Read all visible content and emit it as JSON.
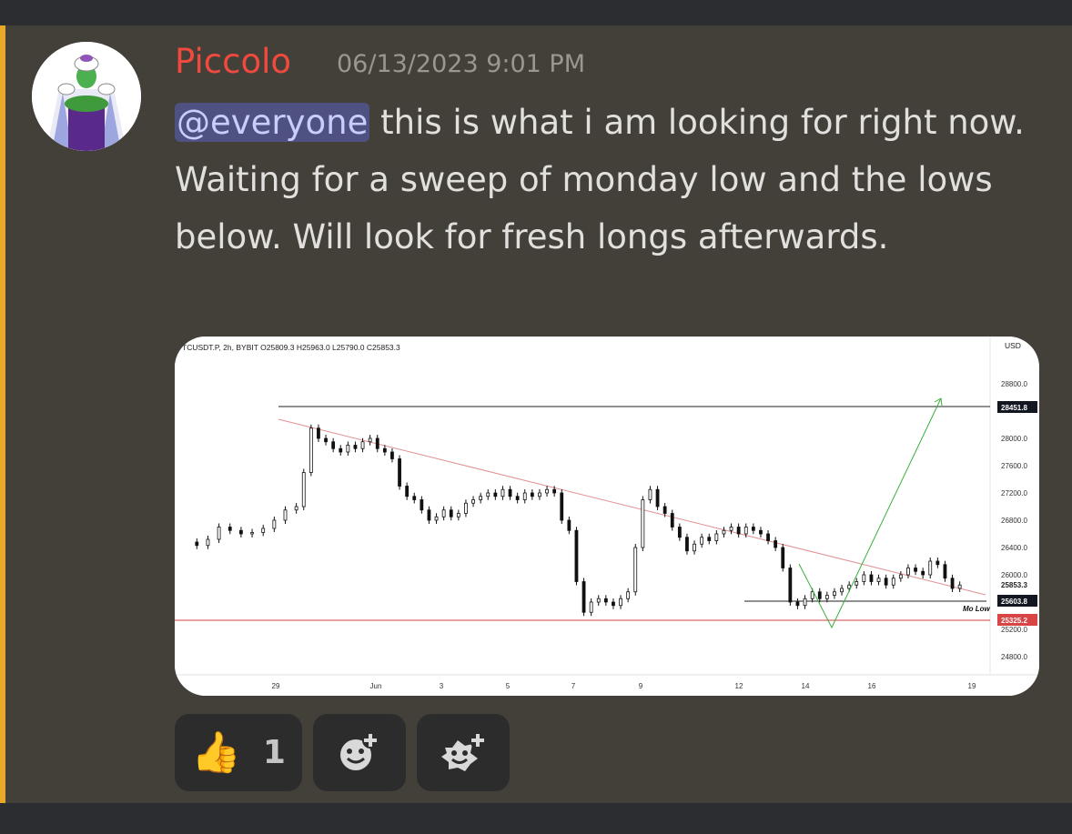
{
  "message": {
    "username": "Piccolo",
    "timestamp": "06/13/2023 9:01 PM",
    "mention": "@everyone",
    "text": " this is what i am looking for right now. Waiting for a sweep of monday low and the lows below. Will look for fresh longs afterwards.",
    "colors": {
      "username": "#f04a3e",
      "accent": "#e8a829",
      "mention_bg": "#4f5183"
    }
  },
  "chart": {
    "header": "TCUSDT.P, 2h, BYBIT  O25809.3  H25963.0  L25790.0  C25853.3",
    "currency": "USD",
    "annotation": "Mo Low",
    "chart_data": {
      "type": "candlestick",
      "symbol": "TCUSDT.P",
      "interval": "2h",
      "exchange": "BYBIT",
      "ohlc_last": {
        "open": 25809.3,
        "high": 25963.0,
        "low": 25790.0,
        "close": 25853.3
      },
      "y_ticks": [
        "28800.0",
        "28000.0",
        "27600.0",
        "27200.0",
        "26800.0",
        "26400.0",
        "26000.0",
        "25200.0",
        "24800.0"
      ],
      "x_ticks": [
        "29",
        "Jun",
        "3",
        "5",
        "7",
        "9",
        "12",
        "14",
        "16",
        "19"
      ],
      "price_labels": [
        {
          "value": "28451.8",
          "style": "dark"
        },
        {
          "value": "25853.3",
          "style": "plain"
        },
        {
          "value": "25603.8",
          "style": "dark"
        },
        {
          "value": "25325.2",
          "style": "red"
        }
      ],
      "annotations": [
        "Mo Low"
      ],
      "path_points": [
        [
          3,
          26480
        ],
        [
          6,
          26430
        ],
        [
          9,
          26520
        ],
        [
          12,
          26700
        ],
        [
          15,
          26650
        ],
        [
          18,
          26600
        ],
        [
          21,
          26620
        ],
        [
          24,
          26680
        ],
        [
          27,
          26800
        ],
        [
          30,
          26950
        ],
        [
          33,
          27000
        ],
        [
          35,
          27500
        ],
        [
          37,
          28150
        ],
        [
          39,
          28000
        ],
        [
          41,
          27950
        ],
        [
          43,
          27850
        ],
        [
          45,
          27800
        ],
        [
          47,
          27900
        ],
        [
          49,
          27850
        ],
        [
          51,
          27950
        ],
        [
          53,
          28000
        ],
        [
          55,
          27850
        ],
        [
          57,
          27800
        ],
        [
          59,
          27700
        ],
        [
          61,
          27300
        ],
        [
          63,
          27150
        ],
        [
          65,
          27100
        ],
        [
          67,
          26950
        ],
        [
          69,
          26800
        ],
        [
          71,
          26850
        ],
        [
          73,
          26950
        ],
        [
          75,
          26850
        ],
        [
          77,
          26900
        ],
        [
          79,
          27050
        ],
        [
          81,
          27100
        ],
        [
          83,
          27150
        ],
        [
          85,
          27200
        ],
        [
          87,
          27150
        ],
        [
          89,
          27250
        ],
        [
          91,
          27150
        ],
        [
          93,
          27100
        ],
        [
          95,
          27200
        ],
        [
          97,
          27150
        ],
        [
          99,
          27200
        ],
        [
          101,
          27250
        ],
        [
          103,
          27200
        ],
        [
          105,
          26800
        ],
        [
          107,
          26650
        ],
        [
          109,
          25900
        ],
        [
          111,
          25450
        ],
        [
          113,
          25600
        ],
        [
          115,
          25650
        ],
        [
          117,
          25600
        ],
        [
          119,
          25550
        ],
        [
          121,
          25650
        ],
        [
          123,
          25750
        ],
        [
          125,
          26400
        ],
        [
          127,
          27100
        ],
        [
          129,
          27250
        ],
        [
          131,
          27000
        ],
        [
          133,
          26900
        ],
        [
          135,
          26700
        ],
        [
          137,
          26550
        ],
        [
          139,
          26350
        ],
        [
          141,
          26450
        ],
        [
          143,
          26550
        ],
        [
          145,
          26500
        ],
        [
          147,
          26600
        ],
        [
          149,
          26650
        ],
        [
          151,
          26700
        ],
        [
          153,
          26600
        ],
        [
          155,
          26700
        ],
        [
          157,
          26650
        ],
        [
          159,
          26600
        ],
        [
          161,
          26500
        ],
        [
          163,
          26400
        ],
        [
          165,
          26100
        ],
        [
          167,
          25600
        ],
        [
          169,
          25550
        ],
        [
          171,
          25650
        ],
        [
          173,
          25750
        ],
        [
          175,
          25650
        ],
        [
          177,
          25700
        ],
        [
          179,
          25750
        ],
        [
          181,
          25800
        ],
        [
          183,
          25850
        ],
        [
          185,
          25900
        ],
        [
          187,
          26000
        ],
        [
          189,
          25900
        ],
        [
          191,
          25950
        ],
        [
          193,
          25850
        ],
        [
          195,
          25950
        ],
        [
          197,
          26000
        ],
        [
          199,
          26100
        ],
        [
          201,
          26050
        ],
        [
          203,
          26000
        ],
        [
          205,
          26200
        ],
        [
          207,
          26150
        ],
        [
          209,
          25950
        ],
        [
          211,
          25800
        ],
        [
          213,
          25850
        ]
      ]
    }
  },
  "reactions": [
    {
      "emoji": "👍",
      "count": "1",
      "icon": "thumbs-up-icon"
    },
    {
      "icon": "add-reaction-icon"
    },
    {
      "icon": "add-super-reaction-icon"
    }
  ]
}
